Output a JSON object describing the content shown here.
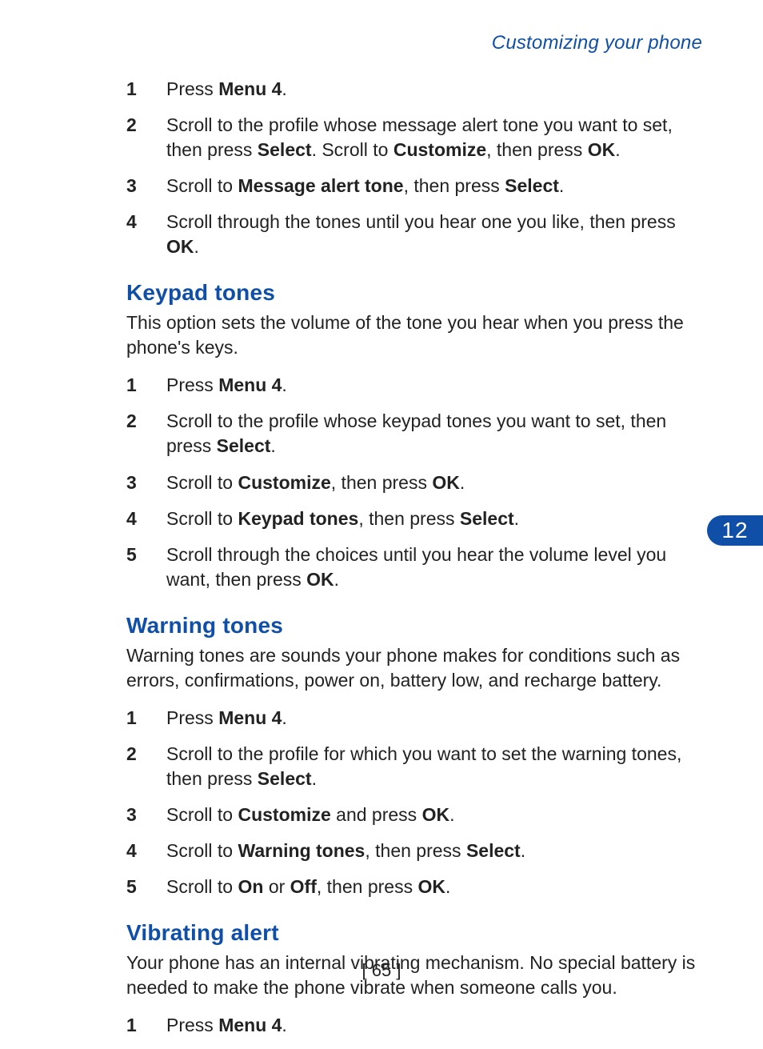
{
  "running_head": "Customizing your phone",
  "chapter_number": "12",
  "page_number": "[ 65 ]",
  "sections": {
    "intro_steps": [
      {
        "n": "1",
        "html": "Press <b>Menu 4</b>."
      },
      {
        "n": "2",
        "html": "Scroll to the profile whose message alert tone you want to set, then press <b>Select</b>. Scroll to <b>Customize</b>, then press <b>OK</b>."
      },
      {
        "n": "3",
        "html": "Scroll to <b>Message alert tone</b>, then press <b>Select</b>."
      },
      {
        "n": "4",
        "html": "Scroll through the tones until you hear one you like, then press <b>OK</b>."
      }
    ],
    "keypad": {
      "title": "Keypad tones",
      "para": "This option sets the volume of the tone you hear when you press the phone's keys.",
      "steps": [
        {
          "n": "1",
          "html": "Press <b>Menu 4</b>."
        },
        {
          "n": "2",
          "html": "Scroll to the profile whose keypad tones you want to set, then press <b>Select</b>."
        },
        {
          "n": "3",
          "html": "Scroll to <b>Customize</b>, then press <b>OK</b>."
        },
        {
          "n": "4",
          "html": "Scroll to <b>Keypad tones</b>, then press <b>Select</b>."
        },
        {
          "n": "5",
          "html": "Scroll through the choices until you hear the volume level you want, then press <b>OK</b>."
        }
      ]
    },
    "warning": {
      "title": "Warning tones",
      "para": "Warning tones are sounds your phone makes for conditions such as errors, confirmations, power on, battery low, and recharge battery.",
      "steps": [
        {
          "n": "1",
          "html": "Press <b>Menu 4</b>."
        },
        {
          "n": "2",
          "html": "Scroll to the profile for which you want to set the warning tones, then press <b>Select</b>."
        },
        {
          "n": "3",
          "html": "Scroll to <b>Customize</b> and press <b>OK</b>."
        },
        {
          "n": "4",
          "html": "Scroll to <b>Warning tones</b>, then press <b>Select</b>."
        },
        {
          "n": "5",
          "html": "Scroll to <b>On</b> or <b>Off</b>, then press <b>OK</b>."
        }
      ]
    },
    "vibrating": {
      "title": "Vibrating alert",
      "para": "Your phone has an internal vibrating mechanism. No special battery is needed to make the phone vibrate when someone calls you.",
      "steps": [
        {
          "n": "1",
          "html": "Press <b>Menu 4</b>."
        }
      ]
    }
  }
}
